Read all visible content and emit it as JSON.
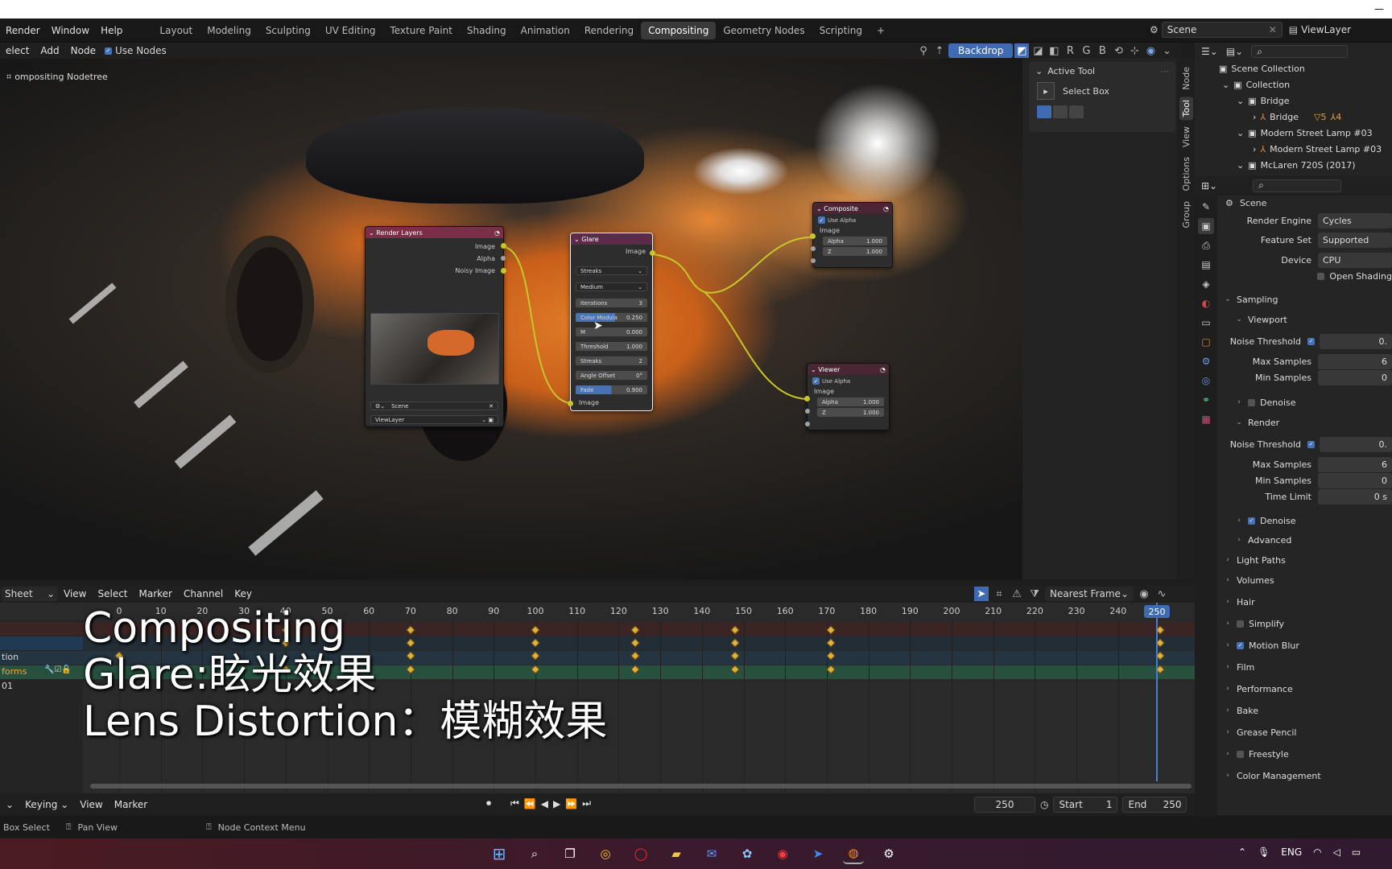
{
  "topbar": {
    "menus": [
      "Render",
      "Window",
      "Help"
    ],
    "workspaces": [
      "Layout",
      "Modeling",
      "Sculpting",
      "UV Editing",
      "Texture Paint",
      "Shading",
      "Animation",
      "Rendering",
      "Compositing",
      "Geometry Nodes",
      "Scripting"
    ],
    "active_workspace": "Compositing",
    "add_tab": "+",
    "scene": "Scene",
    "viewlayer": "ViewLayer"
  },
  "nodeheader": {
    "menus": [
      "elect",
      "Add",
      "Node"
    ],
    "use_nodes": "Use Nodes",
    "backdrop": "Backdrop",
    "channels": [
      "R",
      "G",
      "B"
    ]
  },
  "viewport": {
    "label": "ompositing Nodetree"
  },
  "nodes": {
    "render_layers": {
      "title": "Render Layers",
      "outputs": [
        "Image",
        "Alpha",
        "Noisy Image"
      ],
      "scene": "Scene",
      "viewlayer": "ViewLayer"
    },
    "glare": {
      "title": "Glare",
      "output": "Image",
      "type": "Streaks",
      "quality": "Medium",
      "fields": [
        {
          "label": "Iterations",
          "value": "3"
        },
        {
          "label": "Color Modula",
          "value": "0.250"
        },
        {
          "label": "M",
          "value": "0.000"
        },
        {
          "label": "Threshold",
          "value": "1.000"
        },
        {
          "label": "Streaks",
          "value": "2"
        },
        {
          "label": "Angle Offset",
          "value": "0°"
        },
        {
          "label": "Fade",
          "value": "0.900"
        }
      ],
      "input": "Image"
    },
    "composite": {
      "title": "Composite",
      "use_alpha": "Use Alpha",
      "input": "Image",
      "alpha_label": "Alpha",
      "alpha": "1.000",
      "z_label": "Z",
      "z": "1.000"
    },
    "viewer": {
      "title": "Viewer",
      "use_alpha": "Use Alpha",
      "input": "Image",
      "alpha_label": "Alpha",
      "alpha": "1.000",
      "z_label": "Z",
      "z": "1.000"
    }
  },
  "npanel": {
    "title": "Active Tool",
    "tool": "Select Box",
    "tabs": [
      "Node",
      "Tool",
      "View",
      "Options",
      "Group"
    ],
    "active_tab": "Tool"
  },
  "outliner": {
    "rows": [
      "Scene Collection",
      "Collection",
      "Bridge",
      "Bridge",
      "Modern Street Lamp #03",
      "Modern Street Lamp #03",
      "McLaren 720S (2017)"
    ],
    "badge1": "5",
    "badge2": "4"
  },
  "properties": {
    "title": "Scene",
    "render_engine_label": "Render Engine",
    "render_engine": "Cycles",
    "feature_set_label": "Feature Set",
    "feature_set": "Supported",
    "device_label": "Device",
    "device": "CPU",
    "open_shading": "Open Shading",
    "sampling": "Sampling",
    "viewport": "Viewport",
    "noise_threshold_label": "Noise Threshold",
    "vp_noise": "0.",
    "max_samples_label": "Max Samples",
    "vp_max": "6",
    "min_samples_label": "Min Samples",
    "vp_min": "0",
    "denoise": "Denoise",
    "render": "Render",
    "r_noise": "0.",
    "r_max": "6",
    "r_min": "0",
    "time_limit_label": "Time Limit",
    "time_limit": "0 s",
    "advanced": "Advanced",
    "sections": [
      "Light Paths",
      "Volumes",
      "Hair",
      "Simplify",
      "Motion Blur",
      "Film",
      "Performance",
      "Bake",
      "Grease Pencil",
      "Freestyle",
      "Color Management"
    ]
  },
  "dopesheet": {
    "mode": "Sheet",
    "menus": [
      "View",
      "Select",
      "Marker",
      "Channel",
      "Key"
    ],
    "snap": "Nearest Frame",
    "ticks": [
      "0",
      "10",
      "20",
      "30",
      "40",
      "50",
      "60",
      "70",
      "80",
      "90",
      "100",
      "110",
      "120",
      "130",
      "140",
      "150",
      "160",
      "170",
      "180",
      "190",
      "200",
      "210",
      "220",
      "230",
      "240"
    ],
    "current": "250",
    "channels": [
      "tion",
      "forms",
      "01"
    ]
  },
  "subtitle": {
    "line1": "Compositing",
    "line2": "Glare:眩光效果",
    "line3": "Lens Distortion：模糊效果"
  },
  "playback": {
    "keying": "Keying",
    "view": "View",
    "marker": "Marker",
    "frame": "250",
    "start_label": "Start",
    "start": "1",
    "end_label": "End",
    "end": "250"
  },
  "status": {
    "select": "Box Select",
    "pan": "Pan View",
    "context": "Node Context Menu"
  },
  "taskbar": {
    "lang": "ENG"
  }
}
